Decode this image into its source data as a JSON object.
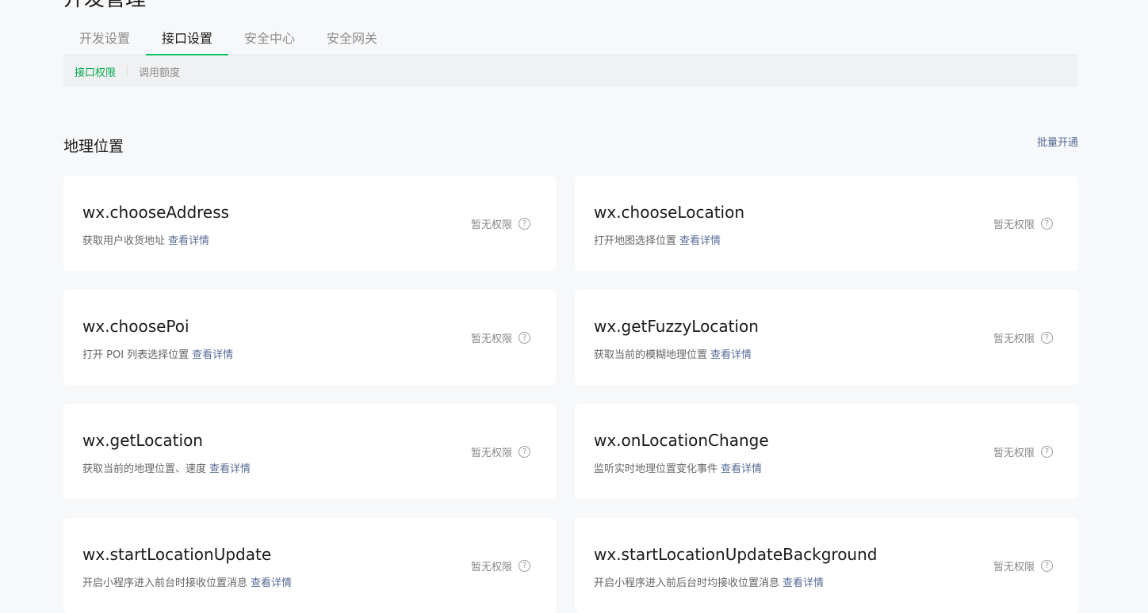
{
  "page_title": "开发管理",
  "tabs": [
    "开发设置",
    "接口设置",
    "安全中心",
    "安全网关"
  ],
  "subtabs": [
    "接口权限",
    "调用额度"
  ],
  "section": {
    "title": "地理位置",
    "batch_label": "批量开通"
  },
  "link_label": "查看详情",
  "status_label": "暂无权限",
  "apis": [
    {
      "name": "wx.chooseAddress",
      "desc": "获取用户收货地址"
    },
    {
      "name": "wx.chooseLocation",
      "desc": "打开地图选择位置"
    },
    {
      "name": "wx.choosePoi",
      "desc": "打开 POI 列表选择位置"
    },
    {
      "name": "wx.getFuzzyLocation",
      "desc": "获取当前的模糊地理位置"
    },
    {
      "name": "wx.getLocation",
      "desc": "获取当前的地理位置、速度"
    },
    {
      "name": "wx.onLocationChange",
      "desc": "监听实时地理位置变化事件"
    },
    {
      "name": "wx.startLocationUpdate",
      "desc": "开启小程序进入前台时接收位置消息"
    },
    {
      "name": "wx.startLocationUpdateBackground",
      "desc": "开启小程序进入前后台时均接收位置消息"
    }
  ]
}
